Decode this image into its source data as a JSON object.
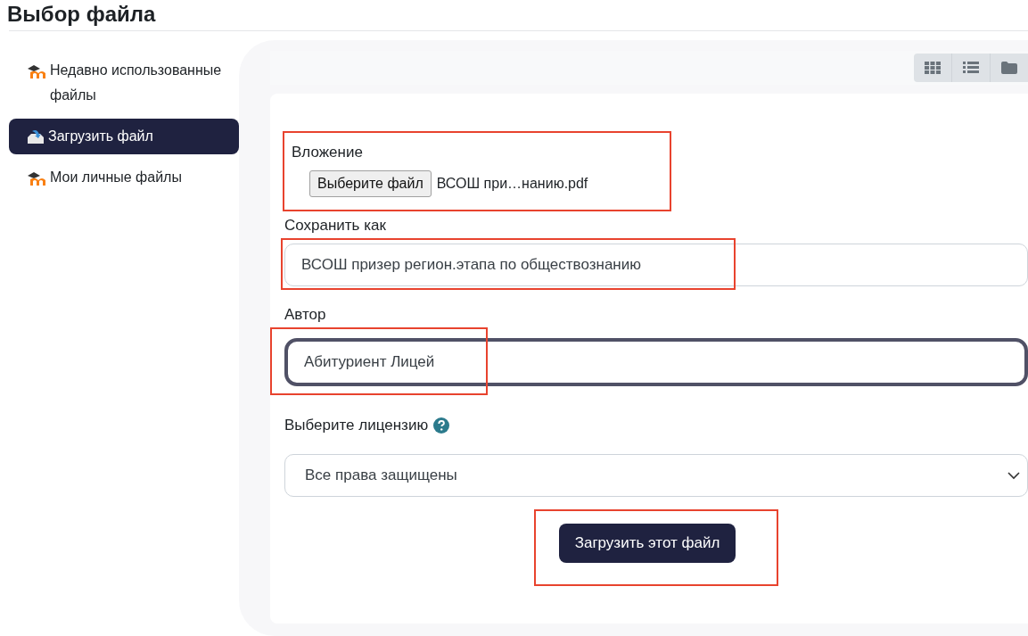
{
  "title": "Выбор файла",
  "sidebar": {
    "items": [
      {
        "label": "Недавно использованные файлы",
        "kind": "repository",
        "selected": false
      },
      {
        "label": "Загрузить файл",
        "kind": "upload",
        "selected": true
      },
      {
        "label": "Мои личные файлы",
        "kind": "repository",
        "selected": false
      }
    ]
  },
  "toolbar": {
    "view_buttons": [
      {
        "kind": "icons"
      },
      {
        "kind": "list"
      },
      {
        "kind": "tree"
      }
    ]
  },
  "form": {
    "attachment": {
      "label": "Вложение",
      "button": "Выберите файл",
      "file_name": "ВСОШ при…нанию.pdf",
      "highlighted": true
    },
    "save_as": {
      "label": "Сохранить как",
      "value": "ВСОШ призер регион.этапа по обществознанию",
      "highlighted": true,
      "focused": false
    },
    "author": {
      "label": "Автор",
      "value": "Абитуриент Лицей",
      "highlighted": true,
      "focused": true
    },
    "license": {
      "label": "Выберите лицензию",
      "value": "Все права защищены"
    },
    "submit": {
      "label": "Загрузить этот файл",
      "highlighted": true
    }
  }
}
